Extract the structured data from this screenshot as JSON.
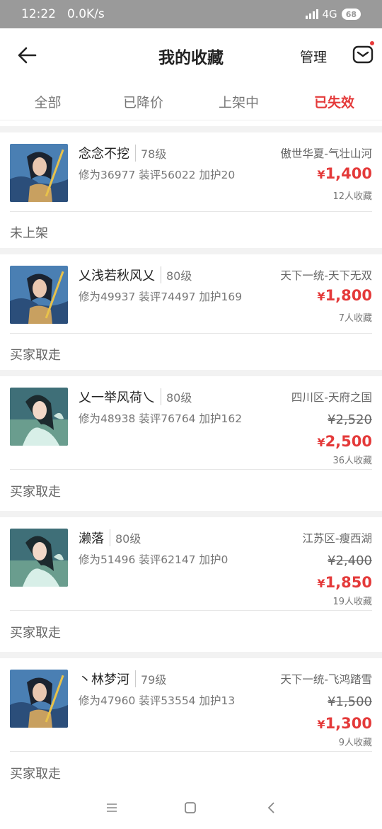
{
  "status": {
    "time": "12:22",
    "speed": "0.0K/s",
    "network": "4G",
    "battery": "68"
  },
  "header": {
    "title": "我的收藏",
    "manage_label": "管理"
  },
  "tabs": [
    {
      "label": "全部"
    },
    {
      "label": "已降价"
    },
    {
      "label": "上架中"
    },
    {
      "label": "已失效"
    }
  ],
  "active_tab": 3,
  "items": [
    {
      "name": "念念不挖",
      "level": "78级",
      "stats": "修为36977 装评56022 加护20",
      "server": "傲世华夏-气壮山河",
      "old_price": "",
      "currency": "¥",
      "price": "1,400",
      "favs": "12人收藏",
      "state": "未上架",
      "avatar": "male"
    },
    {
      "name": "乂浅若秋风乂",
      "level": "80级",
      "stats": "修为49937 装评74497 加护169",
      "server": "天下一统-天下无双",
      "old_price": "",
      "currency": "¥",
      "price": "1,800",
      "favs": "7人收藏",
      "state": "买家取走",
      "avatar": "male"
    },
    {
      "name": "乂一举风荷乀",
      "level": "80级",
      "stats": "修为48938 装评76764 加护162",
      "server": "四川区-天府之国",
      "old_price": "¥2,520",
      "currency": "¥",
      "price": "2,500",
      "favs": "36人收藏",
      "state": "买家取走",
      "avatar": "female"
    },
    {
      "name": "濑落",
      "level": "80级",
      "stats": "修为51496 装评62147 加护0",
      "server": "江苏区-瘦西湖",
      "old_price": "¥2,400",
      "currency": "¥",
      "price": "1,850",
      "favs": "19人收藏",
      "state": "买家取走",
      "avatar": "female"
    },
    {
      "name": "丶林梦河",
      "level": "79级",
      "stats": "修为47960 装评53554 加护13",
      "server": "天下一统-飞鸿踏雪",
      "old_price": "¥1,500",
      "currency": "¥",
      "price": "1,300",
      "favs": "9人收藏",
      "state": "买家取走",
      "avatar": "male"
    }
  ],
  "colors": {
    "accent": "#e43a3a",
    "statusbar": "#9a9a9a"
  }
}
